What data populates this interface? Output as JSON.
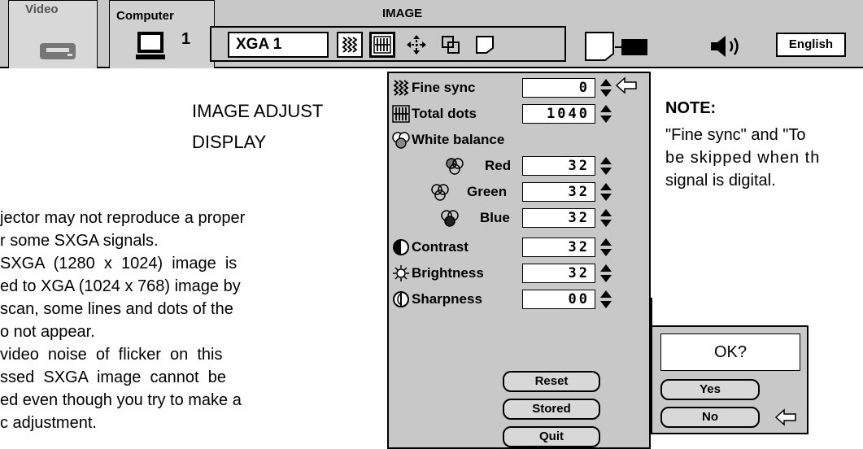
{
  "topbar": {
    "tab_video": "Video",
    "tab_computer": "Computer",
    "computer_number": "1",
    "title": "IMAGE",
    "mode_value": "XGA 1",
    "language": "English"
  },
  "page": {
    "heading_line1": "IMAGE ADJUST",
    "heading_line2": "DISPLAY",
    "body_lines": [
      "jector may not reproduce a proper",
      "r some SXGA signals.",
      "SXGA  (1280  x  1024)  image  is",
      "ed to XGA (1024 x 768) image by",
      "scan, some lines and dots of the",
      "o not appear.",
      "video  noise  of  flicker  on  this",
      "ssed  SXGA  image  cannot  be",
      "ed even though you try to make a",
      "c adjustment."
    ]
  },
  "menu": {
    "items": [
      {
        "label": "Fine sync",
        "value": "0"
      },
      {
        "label": "Total dots",
        "value": "1040"
      },
      {
        "label": "White balance"
      },
      {
        "label": "Red",
        "value": "32"
      },
      {
        "label": "Green",
        "value": "32"
      },
      {
        "label": "Blue",
        "value": "32"
      },
      {
        "label": "Contrast",
        "value": "32"
      },
      {
        "label": "Brightness",
        "value": "32"
      },
      {
        "label": "Sharpness",
        "value": "00"
      }
    ],
    "reset": "Reset",
    "stored": "Stored",
    "quit": "Quit"
  },
  "note": {
    "title": "NOTE:",
    "lines": [
      "\"Fine sync\" and \"To",
      "be skipped when th",
      "signal is digital."
    ]
  },
  "confirm": {
    "prompt": "OK?",
    "yes": "Yes",
    "no": "No"
  },
  "icons": [
    "vcr-icon",
    "computer-icon",
    "fine-sync-icon",
    "total-dots-icon",
    "position-icon",
    "pc-adjust-icon",
    "screen-icon",
    "projector-icon",
    "volume-icon",
    "pointer-arrow-icon",
    "up-down-icon",
    "red-icon",
    "green-icon",
    "blue-icon",
    "contrast-icon",
    "brightness-icon",
    "sharpness-icon",
    "white-balance-icon"
  ]
}
